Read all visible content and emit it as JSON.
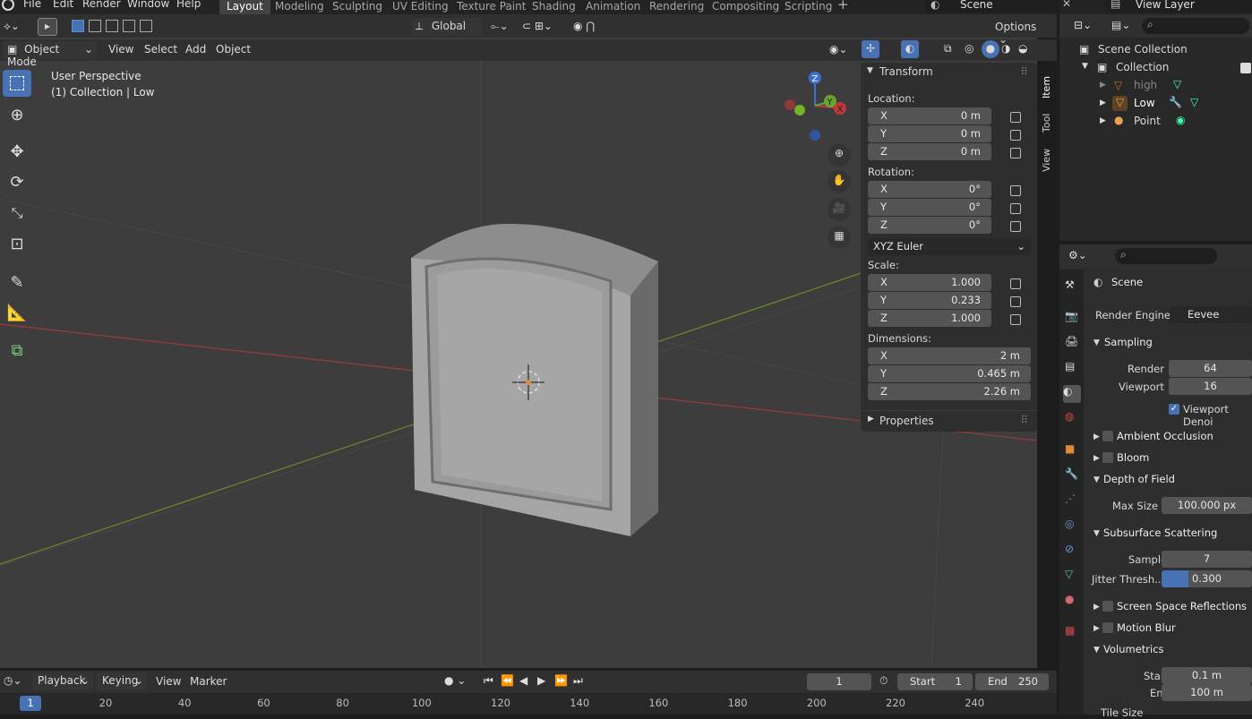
{
  "menu": {
    "items": [
      "File",
      "Edit",
      "Render",
      "Window",
      "Help"
    ]
  },
  "workspaces": [
    "Layout",
    "Modeling",
    "Sculpting",
    "UV Editing",
    "Texture Paint",
    "Shading",
    "Animation",
    "Rendering",
    "Compositing",
    "Scripting"
  ],
  "active_workspace": "Layout",
  "scene_name": "Scene",
  "view_layer": "View Layer",
  "header": {
    "mode": "Object Mode",
    "view": "View",
    "select": "Select",
    "add": "Add",
    "object": "Object",
    "orientation": "Global",
    "options": "Options"
  },
  "viewport": {
    "perspective": "User Perspective",
    "collection_info": "(1) Collection | Low"
  },
  "gizmo": {
    "x": "X",
    "y": "Y",
    "z": "Z"
  },
  "npanel": {
    "tabs": [
      "Item",
      "Tool",
      "View"
    ],
    "transform_title": "Transform",
    "location_label": "Location:",
    "location": [
      {
        "axis": "X",
        "value": "0 m"
      },
      {
        "axis": "Y",
        "value": "0 m"
      },
      {
        "axis": "Z",
        "value": "0 m"
      }
    ],
    "rotation_label": "Rotation:",
    "rotation": [
      {
        "axis": "X",
        "value": "0°"
      },
      {
        "axis": "Y",
        "value": "0°"
      },
      {
        "axis": "Z",
        "value": "0°"
      }
    ],
    "rotation_mode": "XYZ Euler",
    "scale_label": "Scale:",
    "scale": [
      {
        "axis": "X",
        "value": "1.000"
      },
      {
        "axis": "Y",
        "value": "0.233"
      },
      {
        "axis": "Z",
        "value": "1.000"
      }
    ],
    "dimensions_label": "Dimensions:",
    "dimensions": [
      {
        "axis": "X",
        "value": "2 m"
      },
      {
        "axis": "Y",
        "value": "0.465 m"
      },
      {
        "axis": "Z",
        "value": "2.26 m"
      }
    ],
    "properties_title": "Properties"
  },
  "outliner": {
    "scene_collection": "Scene Collection",
    "collection": "Collection",
    "items": [
      {
        "name": "high"
      },
      {
        "name": "Low"
      },
      {
        "name": "Point"
      }
    ]
  },
  "properties": {
    "context": "Scene",
    "render_engine_label": "Render Engine",
    "render_engine": "Eevee",
    "sampling": "Sampling",
    "render_label": "Render",
    "render_value": "64",
    "viewport_label": "Viewport",
    "viewport_value": "16",
    "viewport_denoise": "Viewport Denoi",
    "ambient_occlusion": "Ambient Occlusion",
    "bloom": "Bloom",
    "depth_of_field": "Depth of Field",
    "max_size_label": "Max Size",
    "max_size_value": "100.000 px",
    "sss": "Subsurface Scattering",
    "samples_label": "Samples",
    "samples_value": "7",
    "jitter_label": "Jitter Thresh...",
    "jitter_value": "0.300",
    "jitter_fraction": 0.3,
    "ssr": "Screen Space Reflections",
    "motion_blur": "Motion Blur",
    "volumetrics": "Volumetrics",
    "start_label": "Start",
    "start_value": "0.1 m",
    "end_label": "End",
    "end_value": "100 m",
    "tile_label": "Tile Size"
  },
  "timeline": {
    "playback": "Playback",
    "keying": "Keying",
    "view": "View",
    "marker": "Marker",
    "current_frame": "1",
    "start_label": "Start",
    "start": "1",
    "end_label": "End",
    "end": "250",
    "ticks": [
      "20",
      "40",
      "60",
      "80",
      "100",
      "120",
      "140",
      "160",
      "180",
      "200",
      "220",
      "240"
    ],
    "current_marker": "1"
  }
}
